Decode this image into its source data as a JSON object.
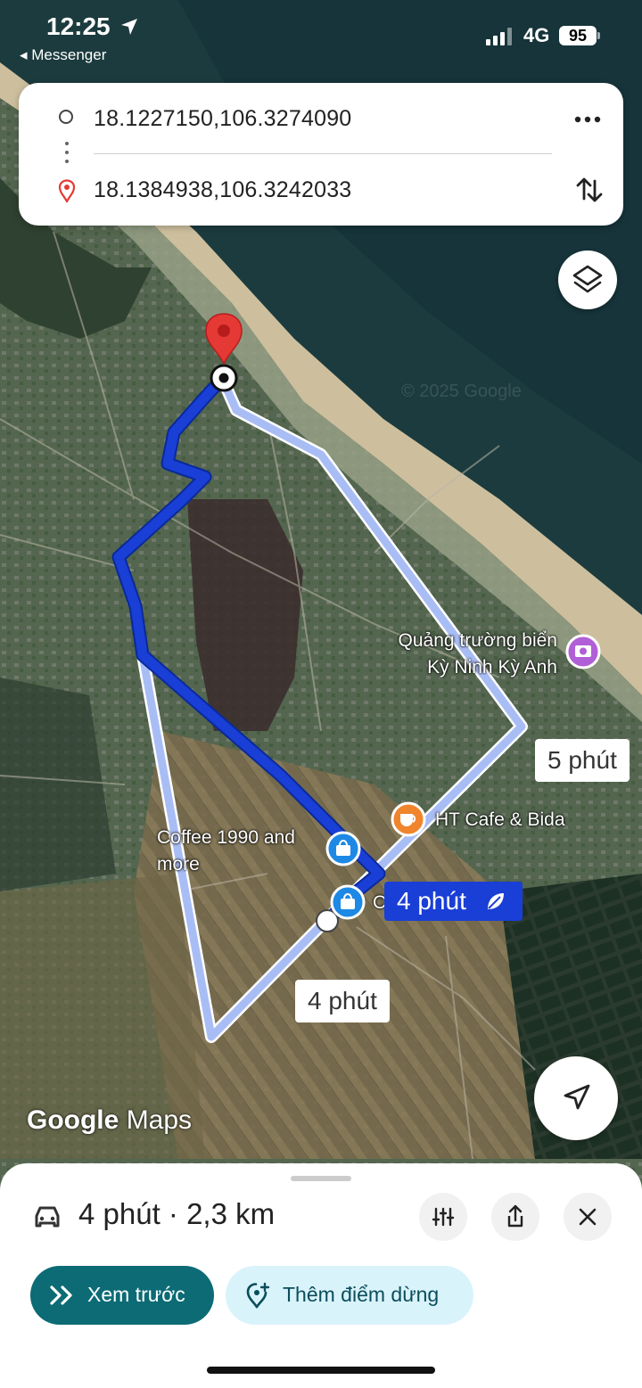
{
  "status_bar": {
    "time": "12:25",
    "back_app": "◂ Messenger",
    "network": "4G",
    "battery": "95"
  },
  "route": {
    "origin": "18.1227150,106.3274090",
    "destination": "18.1384938,106.3242033",
    "more_icon": "more-horizontal-icon",
    "swap_icon": "swap-vertical-icon"
  },
  "map": {
    "places": [
      {
        "name": "Quảng trường biển Kỳ Ninh Kỳ Anh",
        "line1": "Quảng trường biển",
        "line2": "Kỳ Ninh Kỳ Anh",
        "icon": "camera-icon",
        "color": "#b15fd6"
      },
      {
        "name": "HT Cafe & Bida",
        "icon": "cafe-icon",
        "color": "#f0852d"
      },
      {
        "name": "Coffee 1990 and more",
        "line1": "Coffee 1990 and",
        "line2": "more",
        "icon": "shopping-bag-icon",
        "color": "#1e88e5"
      },
      {
        "name": "C",
        "icon": "shopping-bag-icon",
        "color": "#1e88e5"
      }
    ],
    "route_times": {
      "selected": "4 phút",
      "alt_1": "5 phút",
      "alt_2": "4 phút"
    },
    "watermark": "© 2025 Google",
    "brand": {
      "google": "Google",
      "maps": "Maps"
    },
    "route_color": "#1a3fd6",
    "alt_route_color": "#a9bdf5"
  },
  "sheet": {
    "summary": "4 phút · 2,3 km",
    "preview_label": "Xem trước",
    "add_stop_label": "Thêm điểm dừng"
  }
}
